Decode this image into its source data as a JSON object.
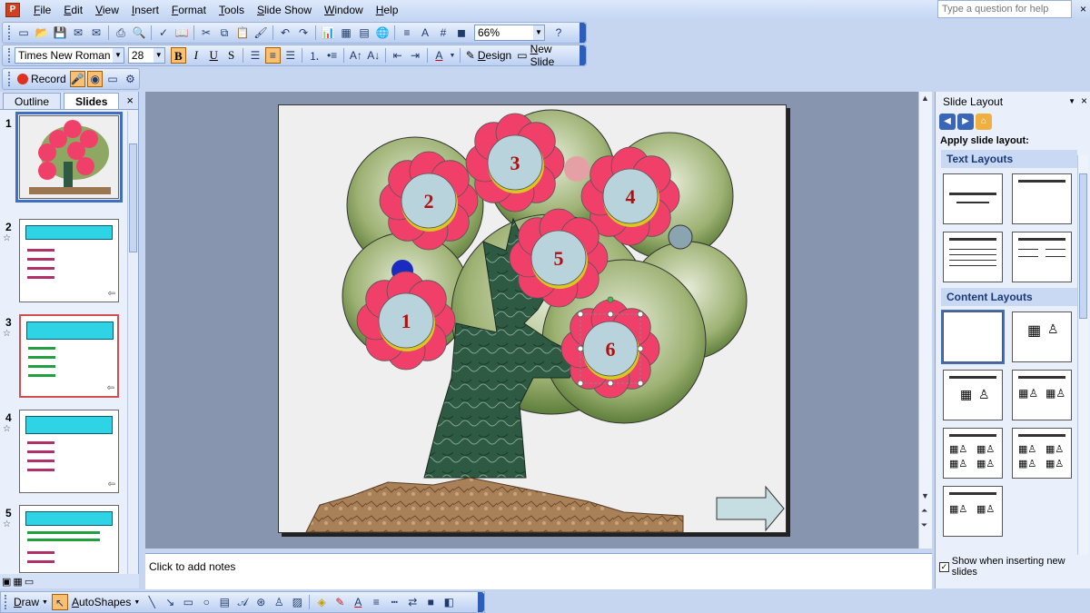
{
  "app": {
    "icon": "powerpoint-icon"
  },
  "menu": [
    "File",
    "Edit",
    "View",
    "Insert",
    "Format",
    "Tools",
    "Slide Show",
    "Window",
    "Help"
  ],
  "help": {
    "placeholder": "Type a question for help",
    "close": "×"
  },
  "standard_toolbar": {
    "zoom": "66%"
  },
  "format_toolbar": {
    "font": "Times New Roman",
    "size": "28",
    "bold": "B",
    "italic": "I",
    "underline": "U",
    "shadow": "S",
    "design": "Design",
    "new_slide": "New Slide"
  },
  "record_toolbar": {
    "record": "Record"
  },
  "outline_pane": {
    "tabs": [
      "Outline",
      "Slides"
    ],
    "active_tab": "Slides",
    "close": "×",
    "slides": [
      {
        "num": "1"
      },
      {
        "num": "2"
      },
      {
        "num": "3"
      },
      {
        "num": "4"
      },
      {
        "num": "5"
      }
    ]
  },
  "slide": {
    "flowers": [
      "1",
      "2",
      "3",
      "4",
      "5",
      "6"
    ],
    "colors": {
      "petal": "#f0406a",
      "center": "#b8d3dc",
      "label": "#b01010",
      "foliage": "#8ea864",
      "trunk": "#2e5a44"
    }
  },
  "notes": {
    "placeholder": "Click to add notes"
  },
  "task_pane": {
    "title": "Slide Layout",
    "apply_label": "Apply slide layout:",
    "text_layouts": "Text Layouts",
    "content_layouts": "Content Layouts",
    "show_checkbox": "Show when inserting new slides",
    "show_checked": true
  },
  "draw_toolbar": {
    "draw": "Draw",
    "autoshapes": "AutoShapes"
  }
}
